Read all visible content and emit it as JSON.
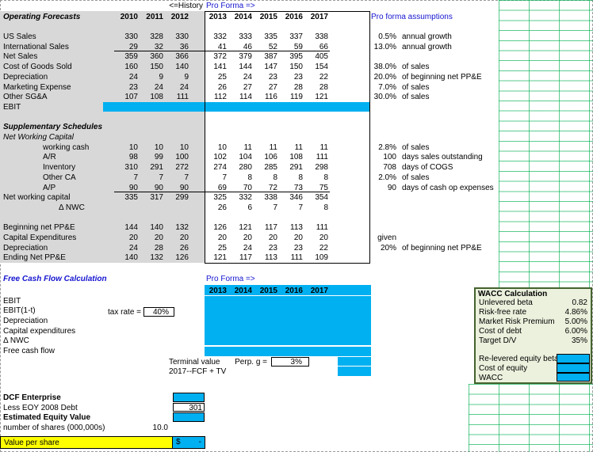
{
  "colors": {
    "highlight_cyan": "#00b0f0",
    "history_gray": "#d8d8d8",
    "input_yellow": "#ffff00",
    "accent_blue": "#1515d0",
    "grid_green": "#00b050",
    "wacc_bg": "#ebf1dd"
  },
  "header": {
    "history_label": "<=History",
    "proforma_label": "Pro Forma =>"
  },
  "top": {
    "title": "Operating Forecasts",
    "assumptions_header": "Pro forma assumptions",
    "history_years": [
      "2010",
      "2011",
      "2012"
    ],
    "proforma_years": [
      "2013",
      "2014",
      "2015",
      "2016",
      "2017"
    ],
    "rows": [
      {
        "spacer": true
      },
      {
        "label": "US Sales",
        "h": [
          "330",
          "328",
          "330"
        ],
        "p": [
          "332",
          "333",
          "335",
          "337",
          "338"
        ],
        "av": "0.5%",
        "at": "annual growth"
      },
      {
        "label": "International Sales",
        "h": [
          "29",
          "32",
          "36"
        ],
        "p": [
          "41",
          "46",
          "52",
          "59",
          "66"
        ],
        "av": "13.0%",
        "at": "annual growth",
        "rule": true
      },
      {
        "label": "Net Sales",
        "h": [
          "359",
          "360",
          "366"
        ],
        "p": [
          "372",
          "379",
          "387",
          "395",
          "405"
        ]
      },
      {
        "label": "Cost of Goods Sold",
        "h": [
          "160",
          "150",
          "140"
        ],
        "p": [
          "141",
          "144",
          "147",
          "150",
          "154"
        ],
        "av": "38.0%",
        "at": "of sales"
      },
      {
        "label": "Depreciation",
        "h": [
          "24",
          "9",
          "9"
        ],
        "p": [
          "25",
          "24",
          "23",
          "23",
          "22"
        ],
        "av": "20.0%",
        "at": "of beginning net PP&E"
      },
      {
        "label": "Marketing Expense",
        "h": [
          "23",
          "24",
          "24"
        ],
        "p": [
          "26",
          "27",
          "27",
          "28",
          "28"
        ],
        "av": "7.0%",
        "at": "of sales"
      },
      {
        "label": "Other SG&A",
        "h": [
          "107",
          "108",
          "111"
        ],
        "p": [
          "112",
          "114",
          "116",
          "119",
          "121"
        ],
        "av": "30.0%",
        "at": "of sales"
      },
      {
        "label": "EBIT",
        "cyan": true
      },
      {
        "spacer": true
      },
      {
        "label": "Supplementary Schedules",
        "bold": true,
        "italic": true
      },
      {
        "label": "Net Working Capital",
        "italic": true
      },
      {
        "label": "working cash",
        "ind": 1,
        "h": [
          "10",
          "10",
          "10"
        ],
        "p": [
          "10",
          "11",
          "11",
          "11",
          "11"
        ],
        "av": "2.8%",
        "at": "of sales"
      },
      {
        "label": "A/R",
        "ind": 1,
        "h": [
          "98",
          "99",
          "100"
        ],
        "p": [
          "102",
          "104",
          "106",
          "108",
          "111"
        ],
        "av": "100",
        "at": "days sales outstanding"
      },
      {
        "label": "Inventory",
        "ind": 1,
        "h": [
          "310",
          "291",
          "272"
        ],
        "p": [
          "274",
          "280",
          "285",
          "291",
          "298"
        ],
        "av": "708",
        "at": "days of COGS"
      },
      {
        "label": "Other CA",
        "ind": 1,
        "h": [
          "7",
          "7",
          "7"
        ],
        "p": [
          "7",
          "8",
          "8",
          "8",
          "8"
        ],
        "av": "2.0%",
        "at": "of sales"
      },
      {
        "label": "A/P",
        "ind": 1,
        "h": [
          "90",
          "90",
          "90"
        ],
        "p": [
          "69",
          "70",
          "72",
          "73",
          "75"
        ],
        "av": "90",
        "at": "days of cash op expenses",
        "rule": true
      },
      {
        "label": "Net working capital",
        "h": [
          "335",
          "317",
          "299"
        ],
        "p": [
          "325",
          "332",
          "338",
          "346",
          "354"
        ]
      },
      {
        "label": "Δ NWC",
        "ind": 2,
        "p": [
          "26",
          "6",
          "7",
          "7",
          "8"
        ]
      },
      {
        "spacer": true
      },
      {
        "label": "Beginning net PP&E",
        "h": [
          "144",
          "140",
          "132"
        ],
        "p": [
          "126",
          "121",
          "117",
          "113",
          "111"
        ]
      },
      {
        "label": "Capital Expenditures",
        "h": [
          "20",
          "20",
          "20"
        ],
        "p": [
          "20",
          "20",
          "20",
          "20",
          "20"
        ],
        "av": "given",
        "at": ""
      },
      {
        "label": "Depreciation",
        "h": [
          "24",
          "28",
          "26"
        ],
        "p": [
          "25",
          "24",
          "23",
          "23",
          "22"
        ],
        "av": "20%",
        "at": "of beginning net PP&E"
      },
      {
        "label": "Ending Net PP&E",
        "h": [
          "140",
          "132",
          "126"
        ],
        "p": [
          "121",
          "117",
          "113",
          "111",
          "109"
        ]
      }
    ]
  },
  "fcf": {
    "title": "Free Cash Flow Calculation",
    "proforma_label": "Pro Forma =>",
    "years": [
      "2013",
      "2014",
      "2015",
      "2016",
      "2017"
    ],
    "rows": [
      "EBIT",
      "EBIT(1-t)",
      "Depreciation",
      "Capital expenditures",
      "Δ NWC",
      "Free cash flow"
    ],
    "tax_rate_label": "tax rate =",
    "tax_rate": "40%",
    "terminal_value_label": "Terminal value",
    "perp_g_label": "Perp. g =",
    "perp_g": "3%",
    "fcf_plus_tv_label": "2017--FCF + TV"
  },
  "dcf": {
    "enterprise_label": "DCF Enterprise",
    "debt_label": "Less EOY 2008 Debt",
    "debt_value": "301",
    "equity_label": "Estimated Equity Value",
    "shares_label": "number of shares (000,000s)",
    "shares_value": "10.0",
    "value_per_share_label": "Value per share",
    "value_per_share_currency": "$",
    "value_per_share_value": "-"
  },
  "wacc": {
    "title": "WACC Calculation",
    "rows": [
      {
        "label": "Unlevered beta",
        "value": "0.82"
      },
      {
        "label": "Risk-free rate",
        "value": "4.86%"
      },
      {
        "label": "Market Risk Premium",
        "value": "5.00%"
      },
      {
        "label": "Cost of debt",
        "value": "6.00%"
      },
      {
        "label": "Target D/V",
        "value": "35%"
      },
      {
        "spacer": true
      },
      {
        "label": "Re-levered equity beta",
        "cyan": true
      },
      {
        "label": "Cost of equity",
        "cyan": true
      },
      {
        "label": "WACC",
        "cyan": true
      }
    ]
  }
}
